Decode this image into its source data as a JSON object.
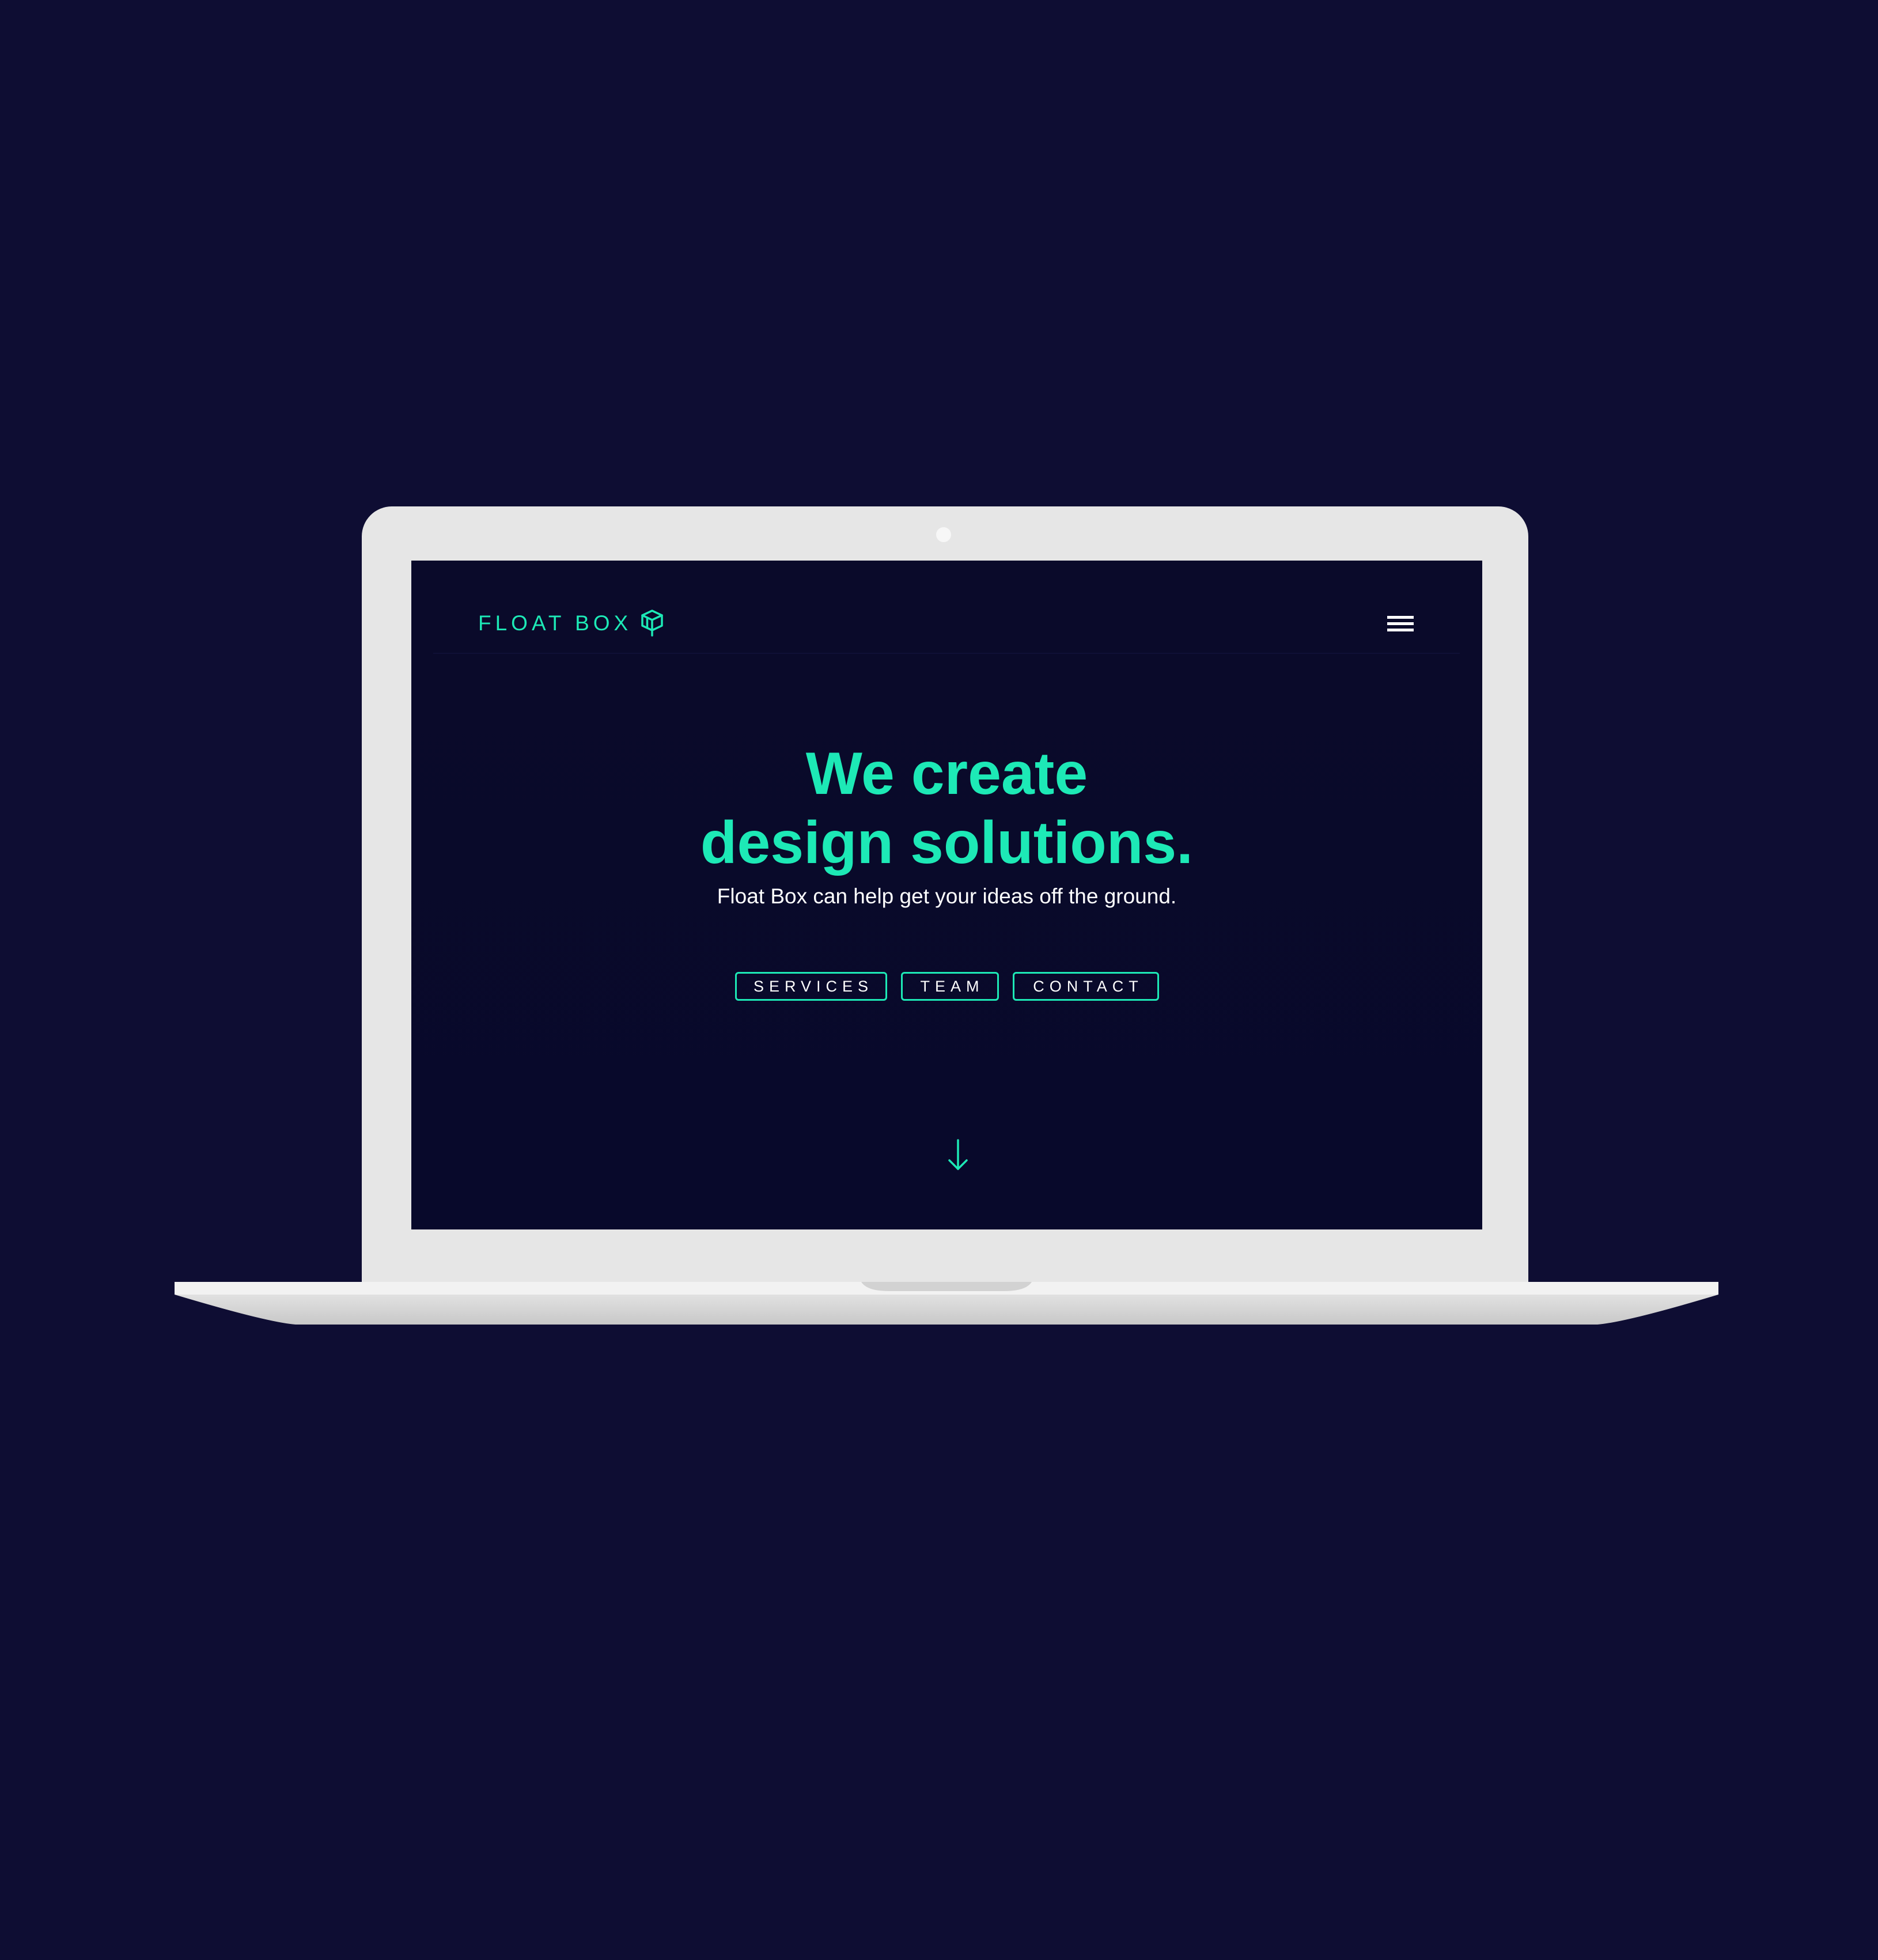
{
  "colors": {
    "page_background": "#0e0d33",
    "screen_background": "#08092b",
    "accent": "#1de9b6",
    "laptop_frame": "#e6e6e6",
    "text": "#ffffff"
  },
  "nav": {
    "brand": "FLOAT BOX",
    "brand_icon": "floating-box-icon",
    "menu_icon": "hamburger-menu-icon"
  },
  "hero": {
    "title_line1": "We create",
    "title_line2": "design solutions.",
    "subtitle": "Float Box can help get your ideas off the ground."
  },
  "buttons": {
    "services": "SERVICES",
    "team": "TEAM",
    "contact": "CONTACT"
  },
  "scroll": {
    "icon": "arrow-down-icon"
  }
}
